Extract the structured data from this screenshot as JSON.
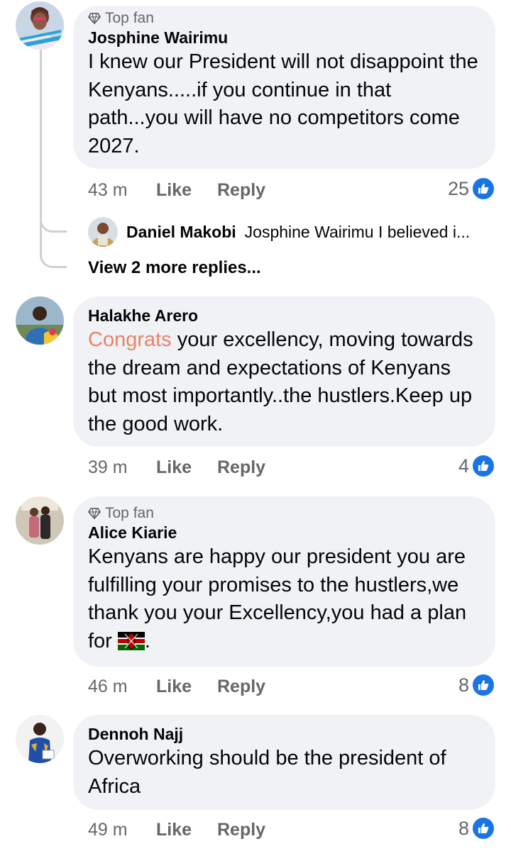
{
  "comments": [
    {
      "badge": "Top fan",
      "author": "Josphine Wairimu",
      "text": "I knew our President will not disappoint the Kenyans.....if you continue in that path...you will have no competitors come 2027.",
      "time": "43 m",
      "like_label": "Like",
      "reply_label": "Reply",
      "reactions": "25"
    },
    {
      "author": "Halakhe Arero",
      "highlight": "Congrats",
      "text": " your excellency, moving towards the dream and expectations of Kenyans but most importantly..the hustlers.Keep up the good work.",
      "time": "39 m",
      "like_label": "Like",
      "reply_label": "Reply",
      "reactions": "4"
    },
    {
      "badge": "Top fan",
      "author": "Alice Kiarie",
      "text": "Kenyans are happy our president you are fulfilling your promises to the hustlers,we thank you your Excellency,you had a plan for ",
      "text_end": ".",
      "time": "46 m",
      "like_label": "Like",
      "reply_label": "Reply",
      "reactions": "8"
    },
    {
      "author": "Dennoh Najj",
      "text": "Overworking should be the president of Africa",
      "time": "49 m",
      "like_label": "Like",
      "reply_label": "Reply",
      "reactions": "8"
    }
  ],
  "reply_preview": {
    "author": "Daniel Makobi",
    "text": "Josphine Wairimu I believed i..."
  },
  "more_replies": "View 2 more replies...",
  "colors": {
    "bubble": "#f0f2f5",
    "meta": "#65676b",
    "like_blue": "#1b74e4",
    "highlight": "#e9826a"
  },
  "icons": [
    "diamond-icon",
    "thumbs-up-icon",
    "kenya-flag-icon"
  ]
}
